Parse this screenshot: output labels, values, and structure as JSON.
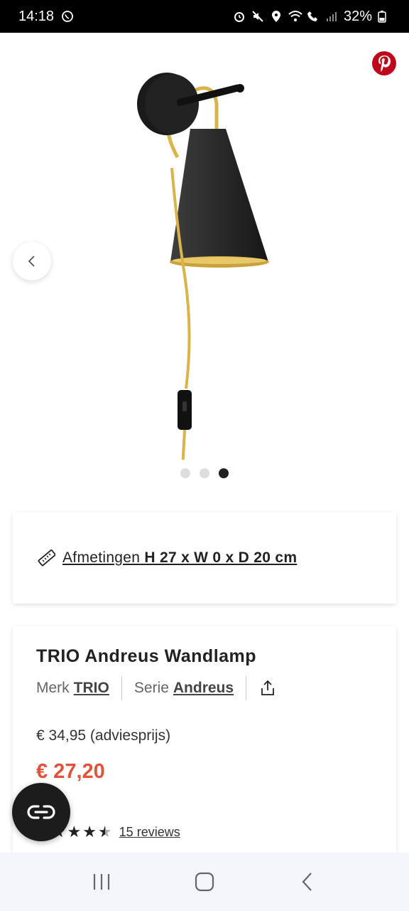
{
  "status_bar": {
    "time": "14:18",
    "battery": "32%"
  },
  "gallery": {
    "image_alt": "TRIO Andreus Wandlamp",
    "dots": [
      false,
      false,
      true
    ]
  },
  "dimensions": {
    "label": "Afmetingen",
    "value": "H 27 x W 0 x D 20 cm"
  },
  "product": {
    "title": "TRIO Andreus Wandlamp",
    "brand_label": "Merk",
    "brand_value": "TRIO",
    "series_label": "Serie",
    "series_value": "Andreus",
    "old_price": "€ 34,95 (adviesprijs)",
    "new_price": "€ 27,20",
    "rating": 4.5,
    "reviews_text": "15 reviews"
  },
  "colors": {
    "accent": "#e0533a",
    "pinterest": "#bd081c",
    "lamp_gold": "#d9b44a"
  },
  "icons": {
    "whatsapp": "whatsapp-icon",
    "share": "share-icon",
    "ruler": "ruler-icon",
    "chat": "chat-icon"
  }
}
